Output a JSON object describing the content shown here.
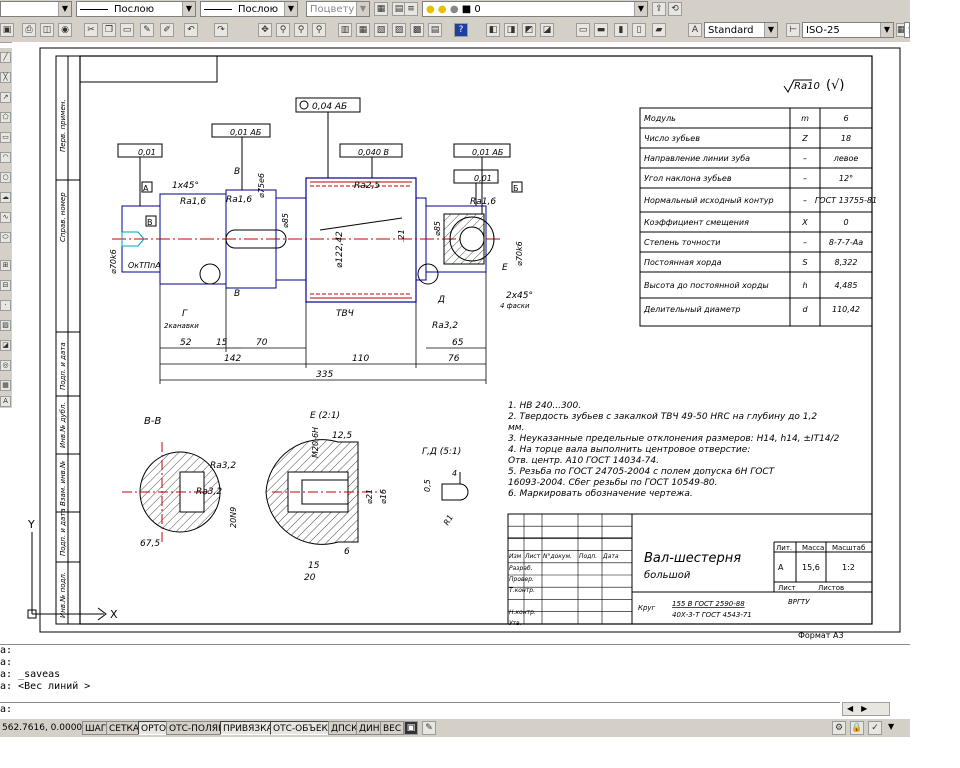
{
  "toolbar1": {
    "linetype_value": "Послою",
    "lineweight_value": "Послою",
    "plotstyle_value": "Поцвету",
    "layer_value": "0"
  },
  "toolbar2": {
    "text_style": "Standard",
    "dim_style": "ISO-25",
    "table_style_partial": "S"
  },
  "drawing": {
    "roughness_general": "Ra10",
    "roughness_paren": "(√)",
    "tolerance_frames": {
      "f1": "0,04 АБ",
      "f2": "0,01 АБ",
      "f3": "0,01",
      "f4": "0,040 В",
      "f5": "0,01 АБ",
      "f6": "0,01"
    },
    "datums": {
      "a": "А",
      "b": "Б",
      "v": "В"
    },
    "labels": {
      "chamfer_left": "1х45°",
      "ra_left": "Ra1,6",
      "ra_left2": "Ra1,6",
      "ra_right": "Ra1,6",
      "ra_mid": "Ra2,5",
      "ra_32": "Ra3,2",
      "d70_left": "⌀70k6",
      "d75": "⌀75e6",
      "d85_left": "⌀85",
      "d122": "⌀122,42",
      "d85_right": "⌀85",
      "d70_right": "⌀70k6",
      "sec_b": "В",
      "sec_b2": "В",
      "center_hole": "ОкТПпА",
      "g_label": "Г",
      "g_sub": "2канавки",
      "tvch": "ТВЧ",
      "d_label": "Д",
      "e_label": "Е",
      "chamfer_right": "2х45°",
      "chamfer_right_sub": "4 фаски",
      "angle_21": ".21"
    },
    "dims": {
      "d52": "52",
      "d15": "15",
      "d70": "70",
      "d142": "142",
      "d110": "110",
      "d65": "65",
      "d76": "76",
      "d335": "335"
    },
    "section_bb": {
      "title": "В-В",
      "ra1": "Ra3,2",
      "ra2": "Ra3,2",
      "width": "67,5",
      "key": "20N9"
    },
    "detail_e": {
      "title": "Е (2:1)",
      "thread": "M20-6H",
      "d125": "12,5",
      "d21": "⌀21",
      "d16": "⌀16",
      "d15": "15",
      "d20": "20",
      "d6": "6"
    },
    "detail_gd": {
      "title": "Г,Д (5:1)",
      "d05": "0,5",
      "d4": "4",
      "r": "R1"
    },
    "side_tags": [
      "Перв. примен.",
      "Справ. номер",
      "Подп. и дата",
      "Инв.№ дубл.",
      "Взам. инв.№",
      "Подп. и дата",
      "Инв.№ подл."
    ],
    "notes": [
      "1.   НВ 240...300.",
      "2.   Твердость зубьев с закалкой ТВЧ 49-50 HRC на глубину до 1,2",
      "       мм.",
      "3.   Неуказанные предельные отклонения размеров: H14, h14, ±IT14/2",
      "4.   На торце вала выполнить центровое отверстие:",
      "       Отв. центр. А10 ГОСТ 14034-74.",
      "5.   Резьба по ГОСТ 24705-2004 с полем допуска 6H ГОСТ",
      "       16093-2004. Сбег резьбы по ГОСТ 10549-80.",
      "6.   Маркировать обозначение чертежа."
    ]
  },
  "gear_table": [
    {
      "name": "Модуль",
      "sym": "m",
      "val": "6"
    },
    {
      "name": "Число зубьев",
      "sym": "Z",
      "val": "18"
    },
    {
      "name": "Направление линии зуба",
      "sym": "–",
      "val": "левое"
    },
    {
      "name": "Угол наклона зубьев",
      "sym": "–",
      "val": "12°"
    },
    {
      "name": "Нормальный исходный контур",
      "sym": "–",
      "val": "ГОСТ 13755-81"
    },
    {
      "name": "Коэффициент смещения",
      "sym": "X",
      "val": "0"
    },
    {
      "name": "Степень точности",
      "sym": "–",
      "val": "8-7-7-Аа"
    },
    {
      "name": "Постоянная хорда",
      "sym": "S",
      "val": "8,322"
    },
    {
      "name": "Высота до постоянной хорды",
      "sym": "h",
      "val": "4,485"
    },
    {
      "name": "Делительный диаметр",
      "sym": "d",
      "val": "110,42"
    }
  ],
  "title_block": {
    "name_line1": "Вал-шестерня",
    "name_line2": "большой",
    "material1": "155 В ГОСТ 2590-88",
    "material2": "40Х-3-Т ГОСТ 4543-71",
    "material_prefix": "Круг",
    "lit": "Лит.",
    "mass": "Масса",
    "scale": "Масштаб",
    "lit_val": "А",
    "mass_val": "15,6",
    "scale_val": "1:2",
    "sheet": "Лист",
    "sheets": "Листов",
    "org": "ВРГТУ",
    "format": "Формат А3",
    "rows": [
      "Изм",
      "Лист",
      "N°докум.",
      "Подп.",
      "Дата"
    ],
    "roles": [
      "Разраб.",
      "Провер.",
      "Т.контр.",
      "",
      "Н.контр.",
      "Утв."
    ]
  },
  "ucs": {
    "x": "X",
    "y": "Y"
  },
  "command_lines": [
    "а:",
    "а:",
    "а:  _saveas",
    "а:  <Вес линий >",
    "",
    "а:"
  ],
  "status": {
    "coords": "562.7616, 0.0000",
    "buttons": [
      "ШАГ",
      "СЕТКА",
      "ОРТО",
      "ОТС-ПОЛЯР",
      "ПРИВЯЗКА",
      "ОТС-ОБЪЕКТ",
      "ДПСК",
      "ДИН",
      "ВЕС"
    ],
    "on": [
      "ОРТО",
      "ПРИВЯЗКА",
      "ОТС-ОБЪЕКТ"
    ]
  }
}
